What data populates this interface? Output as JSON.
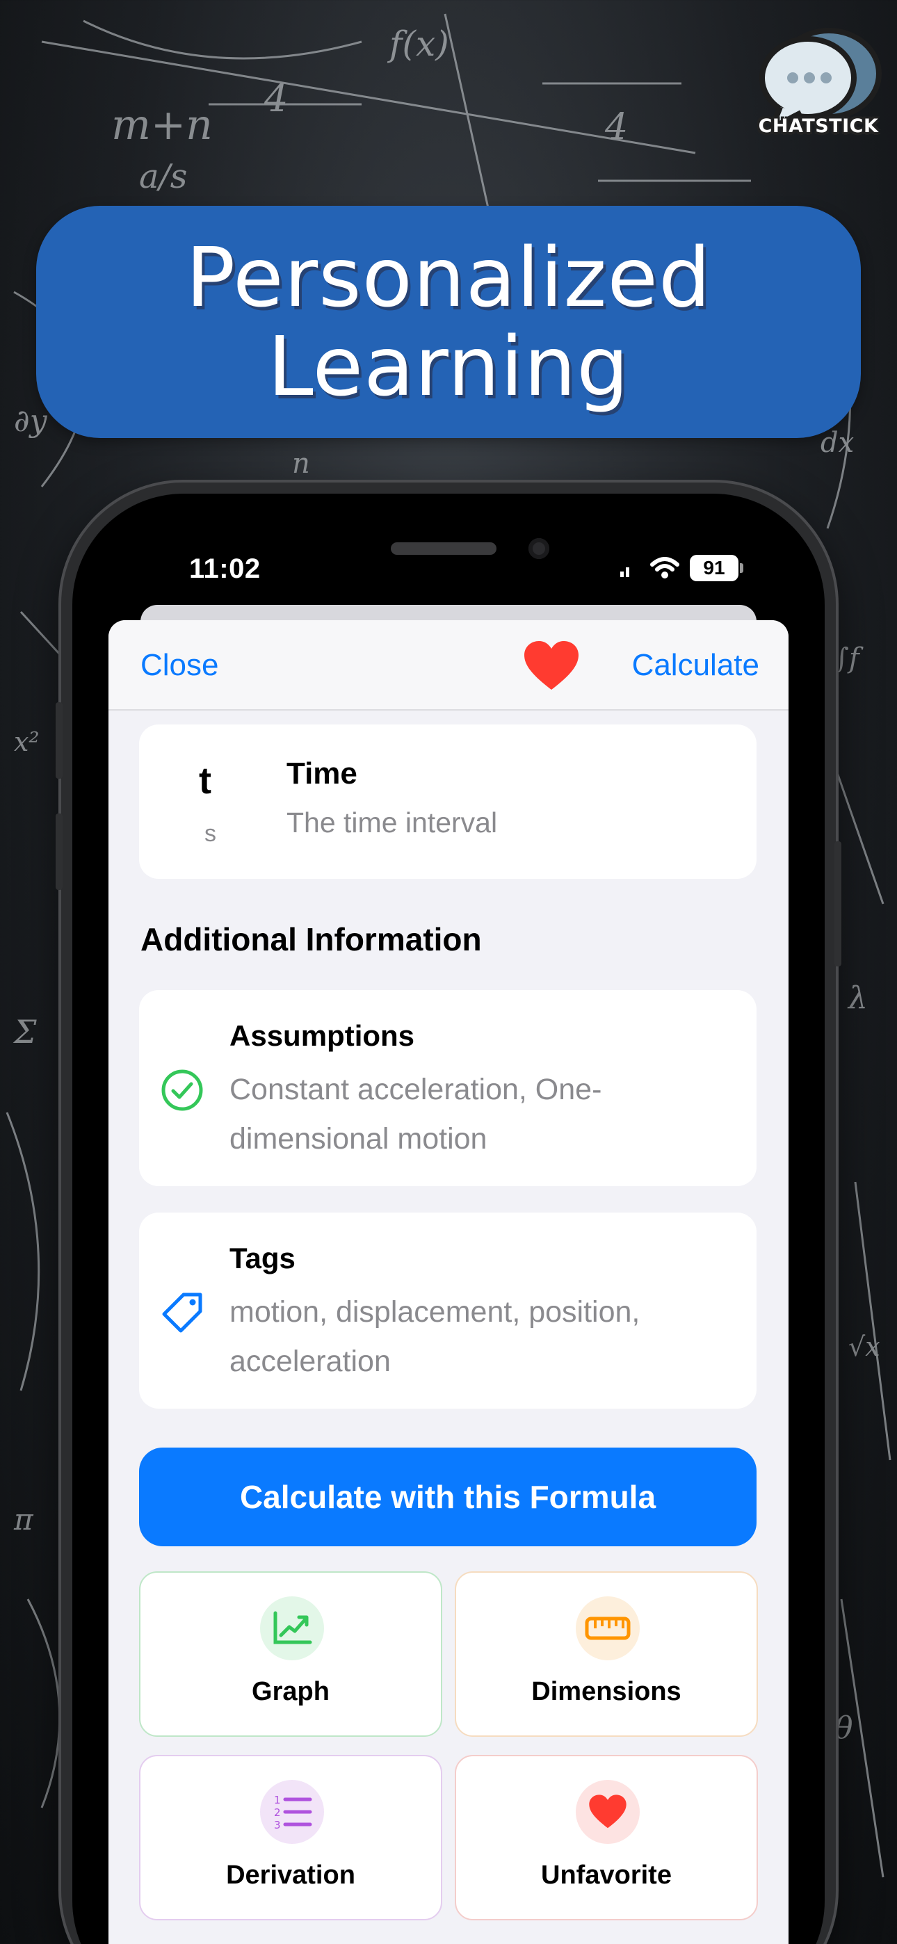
{
  "banner": {
    "title": "Personalized Learning"
  },
  "logo": {
    "label": "CHATSTICK",
    "icon": "chat-bubble-logo"
  },
  "status_bar": {
    "time": "11:02",
    "battery": "91"
  },
  "navbar": {
    "close_label": "Close",
    "calculate_label": "Calculate",
    "favorite_icon": "heart-icon"
  },
  "variable": {
    "symbol": "t",
    "unit": "s",
    "name": "Time",
    "description": "The time interval"
  },
  "additional": {
    "section_title": "Additional Information",
    "assumptions": {
      "title": "Assumptions",
      "body": "Constant acceleration, One-dimensional motion",
      "icon": "checkmark-circle-icon"
    },
    "tags": {
      "title": "Tags",
      "body": "motion, displacement, position, acceleration",
      "icon": "tag-icon"
    }
  },
  "primary_action": {
    "label": "Calculate with this Formula"
  },
  "tiles": {
    "graph": {
      "label": "Graph",
      "icon": "chart-icon",
      "color": "#34c759"
    },
    "dimensions": {
      "label": "Dimensions",
      "icon": "ruler-icon",
      "color": "#ff9500"
    },
    "derivation": {
      "label": "Derivation",
      "icon": "numbered-list-icon",
      "color": "#af52de"
    },
    "unfavorite": {
      "label": "Unfavorite",
      "icon": "heart-icon",
      "color": "#ff3b30"
    }
  },
  "colors": {
    "accent": "#0a7aff",
    "banner": "#2463b5",
    "heart": "#ff3b30"
  }
}
